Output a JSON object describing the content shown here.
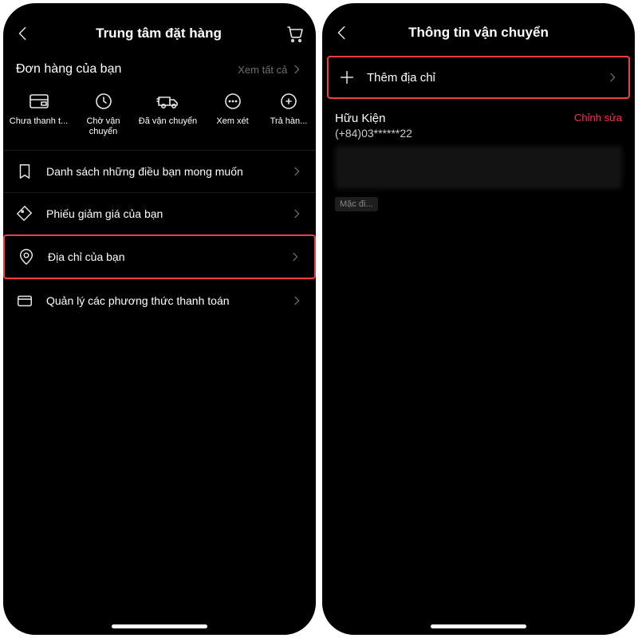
{
  "left": {
    "title": "Trung tâm đặt hàng",
    "section_title": "Đơn hàng của bạn",
    "see_all": "Xem tất cả",
    "statuses": [
      {
        "label": "Chưa thanh t..."
      },
      {
        "label": "Chờ vận chuyển"
      },
      {
        "label": "Đã vận chuyển"
      },
      {
        "label": "Xem xét"
      },
      {
        "label": "Trả hàn..."
      }
    ],
    "menu": [
      {
        "label": "Danh sách những điều bạn mong muốn"
      },
      {
        "label": "Phiếu giảm giá của bạn"
      },
      {
        "label": "Địa chỉ của bạn"
      },
      {
        "label": "Quản lý các phương thức thanh toán"
      }
    ]
  },
  "right": {
    "title": "Thông tin vận chuyển",
    "add_label": "Thêm địa chỉ",
    "address": {
      "name": "Hữu Kiện",
      "phone": "(+84)03******22",
      "edit": "Chỉnh sửa",
      "default_badge": "Mặc đi..."
    }
  }
}
